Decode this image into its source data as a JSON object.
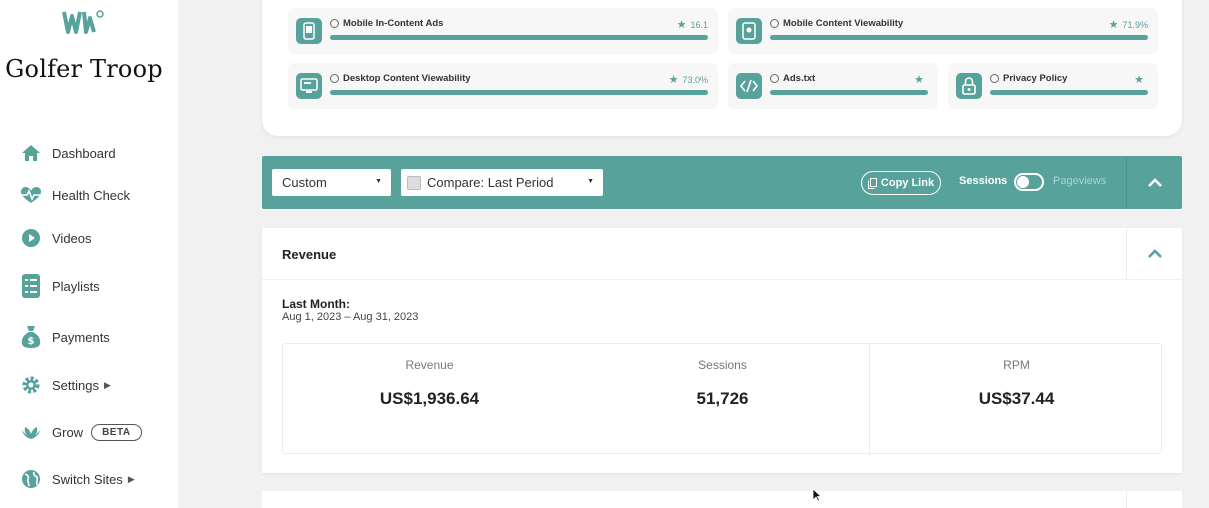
{
  "sidebar": {
    "site_name": "Golfer Troop",
    "items": [
      {
        "label": "Dashboard",
        "icon": "home-icon"
      },
      {
        "label": "Health Check",
        "icon": "heartbeat-icon"
      },
      {
        "label": "Videos",
        "icon": "play-icon"
      },
      {
        "label": "Playlists",
        "icon": "list-icon"
      },
      {
        "label": "Payments",
        "icon": "money-bag-icon"
      },
      {
        "label": "Settings",
        "icon": "gear-icon"
      },
      {
        "label": "Grow",
        "icon": "leaf-icon",
        "badge": "BETA"
      },
      {
        "label": "Switch Sites",
        "icon": "globe-icon"
      }
    ]
  },
  "metrics": [
    {
      "title": "Mobile In-Content Ads",
      "score": "16.1",
      "icon": "mobile-icon"
    },
    {
      "title": "Mobile Content Viewability",
      "score": "71.9%",
      "icon": "mobile-eye-icon"
    },
    {
      "title": "Desktop Content Viewability",
      "score": "73.0%",
      "icon": "desktop-icon"
    },
    {
      "title": "Ads.txt",
      "score": "",
      "icon": "code-icon"
    },
    {
      "title": "Privacy Policy",
      "score": "",
      "icon": "lock-icon"
    }
  ],
  "filters": {
    "range_value": "Custom",
    "compare_value": "Compare: Last Period",
    "copy_link": "Copy Link",
    "toggle_on_label": "Sessions",
    "toggle_off_label": "Pageviews"
  },
  "revenue": {
    "title": "Revenue",
    "period_label": "Last Month:",
    "period_range": "Aug 1, 2023 – Aug 31, 2023",
    "stats": [
      {
        "label": "Revenue",
        "value": "US$1,936.64"
      },
      {
        "label": "Sessions",
        "value": "51,726"
      },
      {
        "label": "RPM",
        "value": "US$37.44"
      }
    ]
  },
  "colors": {
    "accent": "#58a29c"
  }
}
